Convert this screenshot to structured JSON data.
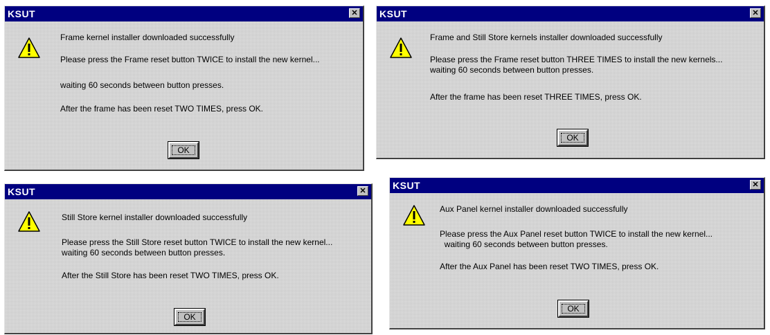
{
  "dialogs": [
    {
      "title": "KSUT",
      "close_label": "✕",
      "lines": [
        "Frame kernel installer downloaded successfully",
        "Please press the Frame reset button TWICE to install the new kernel...",
        "waiting 60 seconds between button presses.",
        "After the frame has been reset TWO TIMES, press OK."
      ],
      "ok_label": "OK"
    },
    {
      "title": "KSUT",
      "close_label": "✕",
      "lines": [
        "Frame and Still Store kernels installer downloaded successfully",
        "Please press the Frame reset button THREE TIMES to install the new kernels...",
        "waiting 60 seconds between button presses.",
        "After the frame has been reset THREE TIMES, press OK."
      ],
      "ok_label": "OK"
    },
    {
      "title": "KSUT",
      "close_label": "✕",
      "lines": [
        "Still Store kernel installer downloaded successfully",
        "Please press the Still Store reset button TWICE to install the new kernel...",
        "waiting 60 seconds between button presses.",
        "After the Still Store has been reset TWO TIMES, press OK."
      ],
      "ok_label": "OK"
    },
    {
      "title": "KSUT",
      "close_label": "✕",
      "lines": [
        "Aux Panel kernel installer downloaded successfully",
        "Please press the Aux Panel reset button TWICE to install the new kernel...",
        "  waiting 60 seconds between button presses.",
        "After the Aux Panel has been reset TWO TIMES, press OK."
      ],
      "ok_label": "OK"
    }
  ],
  "icon": "warning-icon",
  "colors": {
    "titlebar": "#000080",
    "dialog_face": "#c0c0c0",
    "warning_fill": "#ffff00"
  }
}
